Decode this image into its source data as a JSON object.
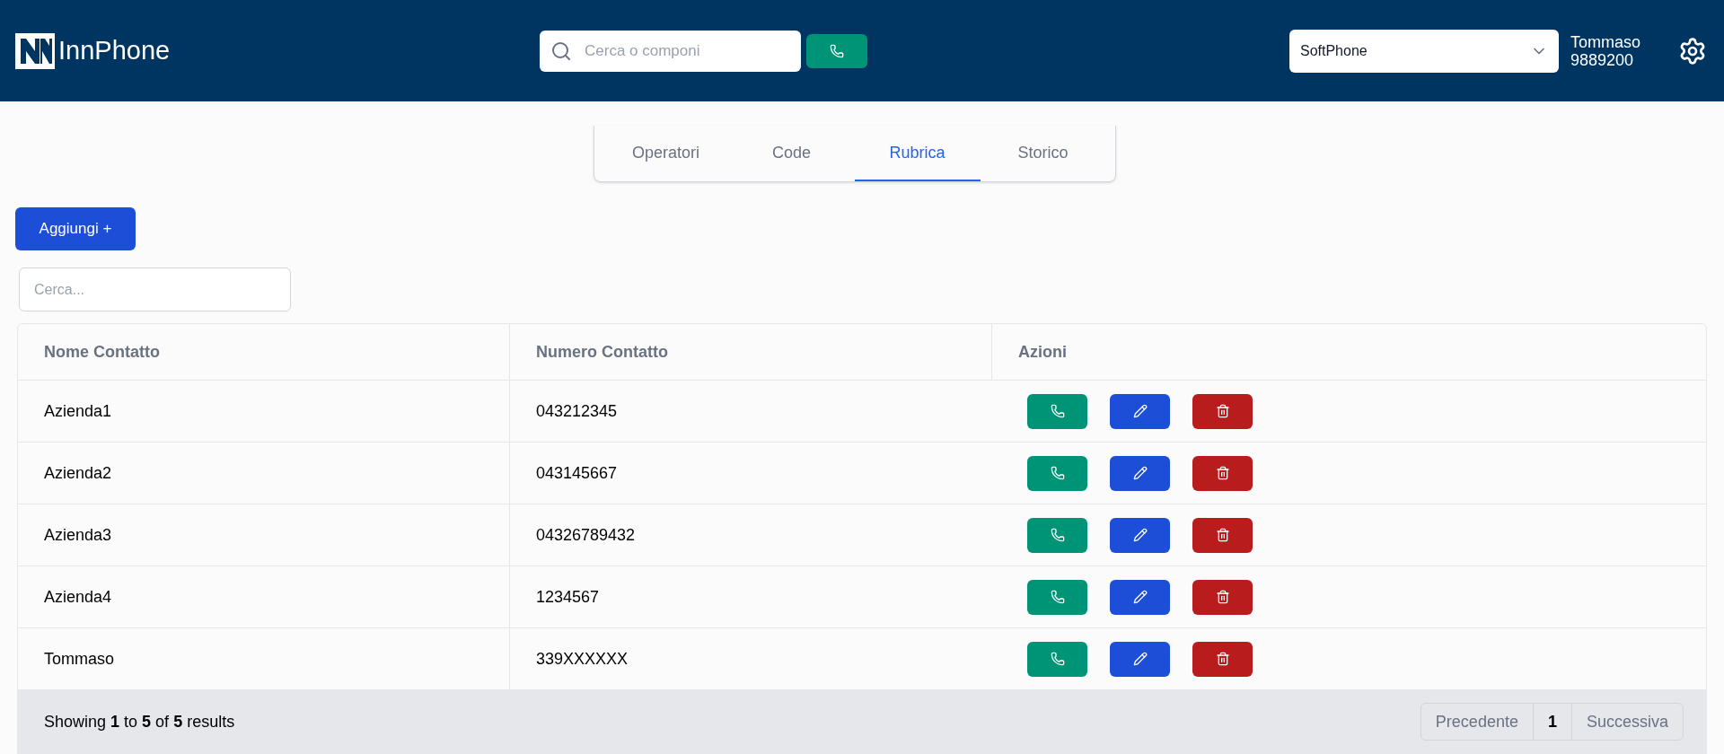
{
  "header": {
    "logo": "InnPhone",
    "search": {
      "placeholder": "Cerca o componi"
    },
    "device_select": {
      "value": "SoftPhone"
    },
    "user": {
      "name": "Tommaso",
      "extension": "9889200"
    }
  },
  "tabs": [
    {
      "label": "Operatori",
      "selected": false
    },
    {
      "label": "Code",
      "selected": false
    },
    {
      "label": "Rubrica",
      "selected": true
    },
    {
      "label": "Storico",
      "selected": false
    }
  ],
  "add_button": "Aggiungi +",
  "filter": {
    "placeholder": "Cerca..."
  },
  "table": {
    "columns": [
      "Nome Contatto",
      "Numero Contatto",
      "Azioni"
    ],
    "rows": [
      {
        "name": "Azienda1",
        "number": "043212345"
      },
      {
        "name": "Azienda2",
        "number": "043145667"
      },
      {
        "name": "Azienda3",
        "number": "04326789432"
      },
      {
        "name": "Azienda4",
        "number": "1234567"
      },
      {
        "name": "Tommaso",
        "number": "339XXXXXX"
      }
    ]
  },
  "footer": {
    "summary": "Showing **1** to **5** of **5** results",
    "pagination": {
      "previous": "Precedente",
      "page": "1",
      "next": "Successiva"
    }
  }
}
